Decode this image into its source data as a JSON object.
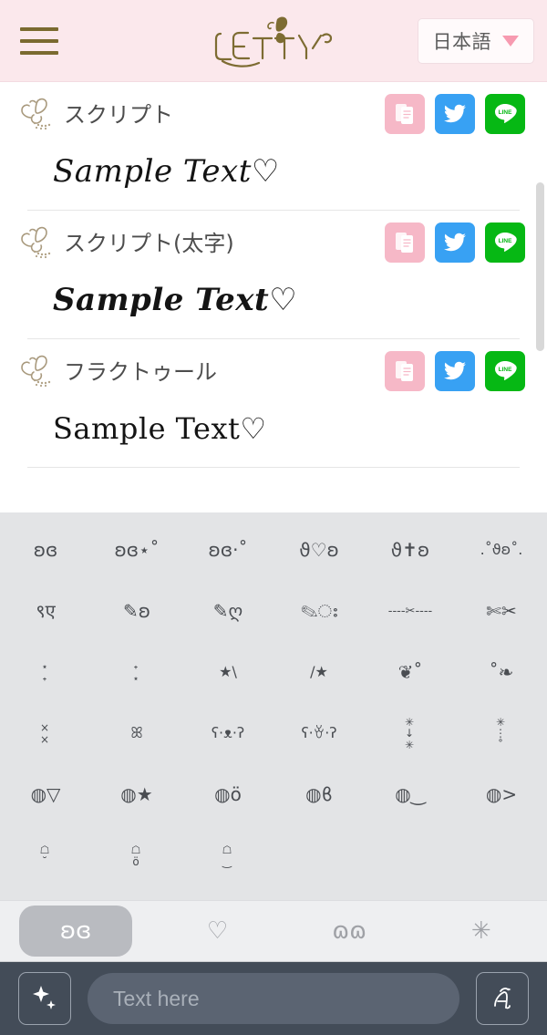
{
  "header": {
    "menu_icon": "hamburger-menu-icon",
    "brand_name": "LETTY",
    "brand_logo_icon": "butterfly-logo-icon",
    "language": {
      "label": "日本語",
      "caret_icon": "chevron-down-icon",
      "caret_color": "#f79ab0"
    },
    "background_color": "#fbe8ec"
  },
  "font_list": {
    "rows": [
      {
        "name": "スクリプト",
        "icon": "butterfly-icon",
        "sample": "Sample Text♡",
        "style": "sample-script",
        "actions": {
          "copy_label": "",
          "copy_icon": "copy-icon",
          "twitter_icon": "twitter-icon",
          "line_icon": "line-icon",
          "line_label": "LINE"
        }
      },
      {
        "name": "スクリプト(太字)",
        "icon": "butterfly-icon",
        "sample": "Sample Text♡",
        "style": "sample-script-bold",
        "actions": {
          "copy_label": "",
          "copy_icon": "copy-icon",
          "twitter_icon": "twitter-icon",
          "line_icon": "line-icon",
          "line_label": "LINE"
        }
      },
      {
        "name": "フラクトゥール",
        "icon": "butterfly-icon",
        "sample": "Sample Text♡",
        "style": "sample-fraktur",
        "actions": {
          "copy_label": "",
          "copy_icon": "copy-icon",
          "twitter_icon": "twitter-icon",
          "line_icon": "line-icon",
          "line_label": "LINE"
        }
      }
    ],
    "colors": {
      "copy_button": "#f6b8c7",
      "twitter_button": "#38a1f3",
      "line_button": "#06b814"
    }
  },
  "symbol_panel": {
    "background_color": "#e3e4e6",
    "symbols": [
      {
        "text": "ʚɞ",
        "size": "normal"
      },
      {
        "text": "ʚɞ⋆˚",
        "size": "normal"
      },
      {
        "text": "ʚɞ·˚",
        "size": "normal"
      },
      {
        "text": "ϑ♡ʚ",
        "size": "normal"
      },
      {
        "text": "ϑ✝ʚ",
        "size": "normal"
      },
      {
        "text": ".˚ϑʚ˚.",
        "size": "small"
      },
      {
        "text": "९ए",
        "size": "normal"
      },
      {
        "text": "✎ʚ",
        "size": "normal"
      },
      {
        "text": "✎ღ",
        "size": "normal"
      },
      {
        "text": "✎ഃ",
        "size": "normal"
      },
      {
        "text": "----✂----",
        "size": "tiny"
      },
      {
        "text": "✄✂",
        "size": "normal"
      },
      {
        "text": "⋆\n˖",
        "size": "stack"
      },
      {
        "text": "˖\n⋆",
        "size": "stack"
      },
      {
        "text": "★\\",
        "size": "small"
      },
      {
        "text": "/★",
        "size": "small"
      },
      {
        "text": "❦˚",
        "size": "normal"
      },
      {
        "text": "˚❧",
        "size": "normal"
      },
      {
        "text": "×\n×",
        "size": "stack"
      },
      {
        "text": "ꕤ",
        "size": "small"
      },
      {
        "text": "ʕ·ᴥ·ʔ",
        "size": "small"
      },
      {
        "text": "ʕ·ꈊ·ʔ",
        "size": "small"
      },
      {
        "text": "✳\n↓\n✳",
        "size": "stack"
      },
      {
        "text": "✳\n⋮\n˚",
        "size": "stack"
      },
      {
        "text": "◍▽",
        "size": "normal"
      },
      {
        "text": "◍★",
        "size": "normal"
      },
      {
        "text": "◍ö",
        "size": "normal"
      },
      {
        "text": "◍ϐ",
        "size": "normal"
      },
      {
        "text": "◍‿",
        "size": "normal"
      },
      {
        "text": "◍>",
        "size": "normal"
      },
      {
        "text": "☖\n˘",
        "size": "stack"
      },
      {
        "text": "☖\nö",
        "size": "stack"
      },
      {
        "text": "☖\n‿",
        "size": "stack"
      }
    ]
  },
  "tab_bar": {
    "background_color": "#eeeff1",
    "active_pill_color": "#b9bbc0",
    "tabs": [
      {
        "icon": "heart-wings-icon",
        "glyph": "ʚɞ",
        "active": true
      },
      {
        "icon": "heart-outline-icon",
        "glyph": "♡",
        "active": false
      },
      {
        "icon": "curls-icon",
        "glyph": "ɷɷ",
        "active": false
      },
      {
        "icon": "star-sparkle-icon",
        "glyph": "✳",
        "active": false
      }
    ]
  },
  "bottom_bar": {
    "background_color": "#434c58",
    "sparkle_icon": "sparkles-icon",
    "font_style_icon": "script-a-icon",
    "input": {
      "value": "",
      "placeholder": "Text here"
    }
  }
}
